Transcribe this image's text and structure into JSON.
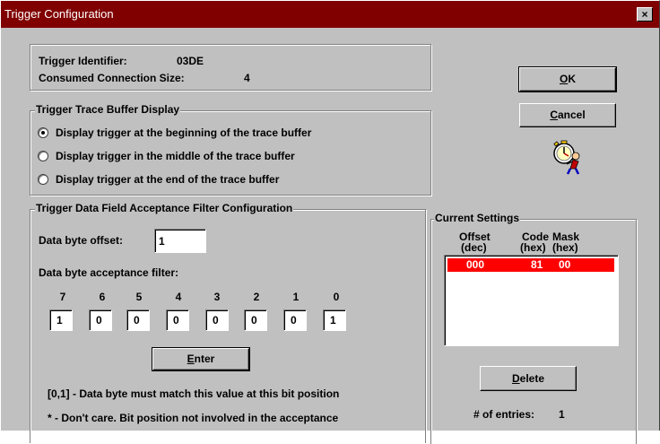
{
  "window": {
    "title": "Trigger Configuration",
    "close_label": "×"
  },
  "info": {
    "identifier_label": "Trigger Identifier:",
    "identifier_value": "03DE",
    "size_label": "Consumed Connection Size:",
    "size_value": "4"
  },
  "buttons": {
    "ok": "OK",
    "ok_accel": "O",
    "ok_rest": "K",
    "cancel_accel": "C",
    "cancel_rest": "ancel",
    "enter_accel": "E",
    "enter_rest": "nter",
    "delete_accel": "D",
    "delete_rest": "elete"
  },
  "trace": {
    "legend": "Trigger Trace Buffer Display",
    "options": [
      {
        "label": "Display trigger at the beginning of the trace buffer",
        "selected": true
      },
      {
        "label": "Display trigger in the middle of the trace buffer",
        "selected": false
      },
      {
        "label": "Display trigger at the end of the trace buffer",
        "selected": false
      }
    ]
  },
  "filter": {
    "legend": "Trigger Data Field Acceptance Filter Configuration",
    "offset_label": "Data byte offset:",
    "offset_value": "1",
    "acceptance_label": "Data byte acceptance filter:",
    "bit_labels": [
      "7",
      "6",
      "5",
      "4",
      "3",
      "2",
      "1",
      "0"
    ],
    "bit_values": [
      "1",
      "0",
      "0",
      "0",
      "0",
      "0",
      "0",
      "1"
    ],
    "help1": "[0,1] - Data byte must match this value at this bit position",
    "help2": "* - Don't care.  Bit position not involved in the acceptance"
  },
  "current": {
    "legend": "Current Settings",
    "col_offset": "Offset",
    "col_offset_unit": "(dec)",
    "col_code": "Code",
    "col_code_unit": "(hex)",
    "col_mask": "Mask",
    "col_mask_unit": "(hex)",
    "rows": [
      {
        "offset": "000",
        "code": "81",
        "mask": "00"
      }
    ],
    "entries_label": "# of entries:",
    "entries_value": "1",
    "highlight_color": "#ff0000"
  }
}
